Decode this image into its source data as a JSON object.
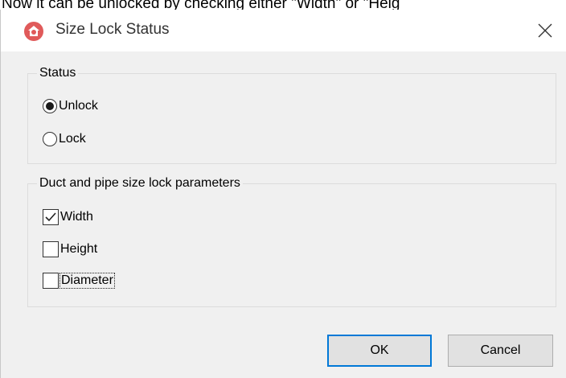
{
  "above_text": "Now it can be unlocked by checking either \"Width\" or \"Heig",
  "window": {
    "title": "Size Lock Status",
    "app_icon": "revit-app-icon",
    "close_icon": "close-icon",
    "accent_color": "#d9363e"
  },
  "status_group": {
    "legend": "Status",
    "options": [
      {
        "label": "Unlock",
        "selected": true
      },
      {
        "label": "Lock",
        "selected": false
      }
    ]
  },
  "params_group": {
    "legend": "Duct and pipe size lock parameters",
    "items": [
      {
        "label": "Width",
        "checked": true
      },
      {
        "label": "Height",
        "checked": false
      },
      {
        "label": "Diameter",
        "checked": false
      }
    ]
  },
  "buttons": {
    "ok_label": "OK",
    "cancel_label": "Cancel"
  }
}
